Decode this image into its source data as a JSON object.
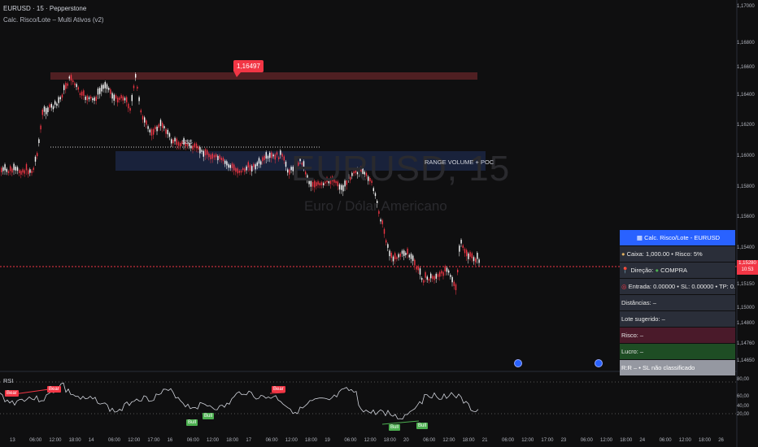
{
  "header": {
    "symbol_line": "EURUSD · 15 · Pepperstone",
    "indicator_line": "Calc. Risco/Lote – Multi Ativos (v2)"
  },
  "watermark": {
    "symbol": "EURUSD, 15",
    "subtitle": "Euro / Dólar Americano"
  },
  "annotations": {
    "price_callout": "1,16497",
    "liquidity_label": "$$$",
    "range_label": "RANGE VOLUME + POC"
  },
  "price_axis": {
    "ticks": [
      "1,17000",
      "1,16800",
      "1,16600",
      "1,16400",
      "1,16200",
      "1,16000",
      "1,15800",
      "1,15600",
      "1,15400",
      "1,15200",
      "1,15150",
      "1,15000",
      "1,14800",
      "1,14760",
      "1,14650"
    ],
    "current_price": "1,15280",
    "countdown": "10:53"
  },
  "rsi": {
    "label": "RSI",
    "ticks": [
      "80,00",
      "60,00",
      "40,00",
      "20,00"
    ],
    "bear_tags": [
      "Bear",
      "Bear",
      "Bear"
    ],
    "bull_tags": [
      "Bull",
      "Bull",
      "Bull",
      "Bull"
    ]
  },
  "time_axis": {
    "ticks": [
      "13",
      "06:00",
      "12:00",
      "18:00",
      "14",
      "06:00",
      "12:00",
      "17:00",
      "16",
      "06:00",
      "12:00",
      "18:00",
      "17",
      "06:00",
      "12:00",
      "18:00",
      "19",
      "06:00",
      "12:00",
      "18:00",
      "20",
      "06:00",
      "12:00",
      "18:00",
      "21",
      "06:00",
      "12:00",
      "17:00",
      "23",
      "06:00",
      "12:00",
      "18:00",
      "24",
      "06:00",
      "12:00",
      "18:00",
      "26"
    ]
  },
  "calc_panel": {
    "title": "Calc. Risco/Lote - EURUSD",
    "caixa": "Caixa: 1,000.00  •  Risco: 5%",
    "direcao_label": "Direção:",
    "direcao_value": "COMPRA",
    "entrada": "Entrada: 0.00000  •  SL: 0.00000  •  TP: 0.00000",
    "distancias": "Distâncias: –",
    "lote": "Lote sugerido: –",
    "risco": "Risco: –",
    "lucro": "Lucro: –",
    "rr": "R:R –  •  SL não classificado"
  },
  "colors": {
    "background": "#0f0f10",
    "bull_candle": "#ffffff",
    "bear_candle": "#f23645",
    "panel_title": "#2962ff",
    "panel_row": "#2a2e39",
    "risk_row": "#4a1a2a",
    "profit_row": "#1e4d24",
    "rr_row": "#9598a1"
  },
  "icons": {
    "caixa": "money-bag-icon",
    "direcao": "pin-icon",
    "direcao_status": "green-circle-icon",
    "entrada": "target-icon",
    "title": "calculator-icon"
  }
}
